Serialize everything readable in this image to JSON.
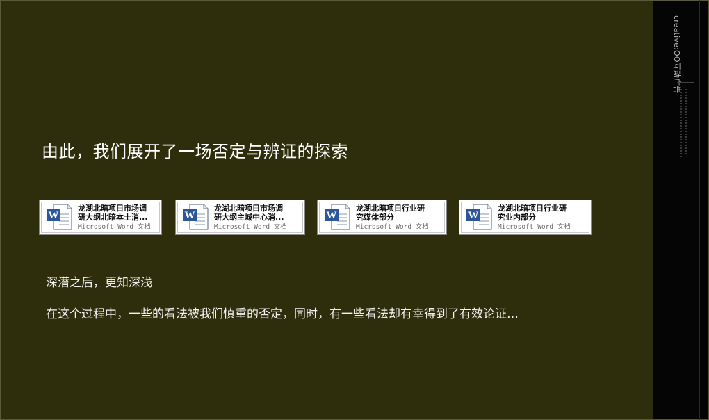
{
  "slide": {
    "heading": "由此，我们展开了一场否定与辨证的探索",
    "subheading": "深潜之后，更知深浅",
    "body": "在这个过程中，一些的看法被我们慎重的否定，同时，有一些看法却有幸得到了有效论证…"
  },
  "attachments": [
    {
      "title": "龙湖北暗项目市场调\n研大纲北暗本土消...",
      "type": "Microsoft Word 文档",
      "icon": "word-document-icon"
    },
    {
      "title": "龙湖北暗项目市场调\n研大纲主城中心消...",
      "type": "Microsoft Word 文档",
      "icon": "word-document-icon"
    },
    {
      "title": "龙湖北暗项目行业研\n究媒体部分",
      "type": "Microsoft Word 文档",
      "icon": "word-document-icon"
    },
    {
      "title": "龙湖北暗项目行业研\n究业内部分",
      "type": "Microsoft Word 文档",
      "icon": "word-document-icon"
    }
  ],
  "sidebar": {
    "brand": "creative:OO互动广告"
  },
  "colors": {
    "slide_background": "#2e2e0c",
    "sidebar_background": "#050505",
    "text": "#ffffff",
    "word_blue": "#2b579a"
  }
}
